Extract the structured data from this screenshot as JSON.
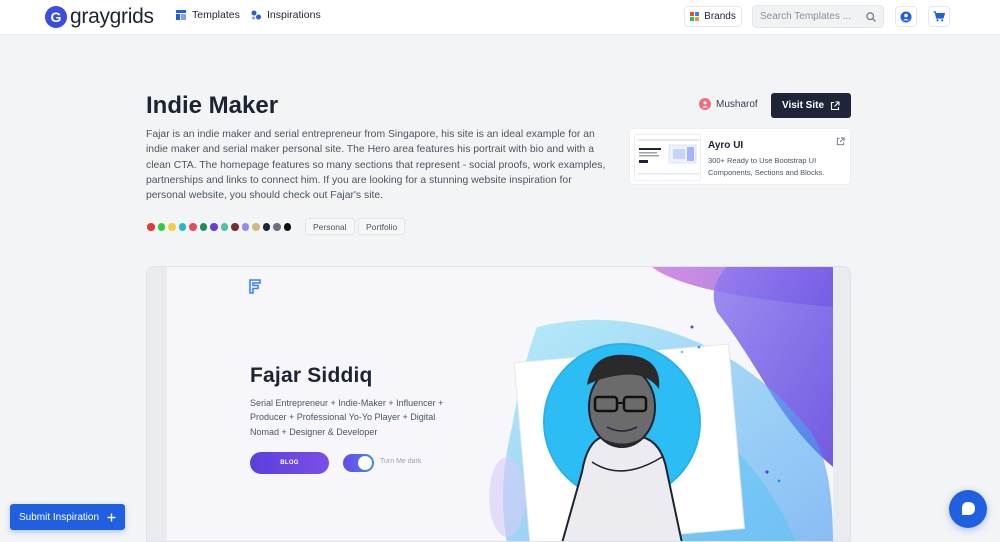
{
  "brand": {
    "logo_letter": "G",
    "name": "graygrids"
  },
  "nav": {
    "templates": "Templates",
    "inspirations": "Inspirations",
    "brands": "Brands",
    "search_placeholder": "Search Templates ..."
  },
  "page": {
    "title": "Indie Maker",
    "description": "Fajar is an indie maker and serial entrepreneur from Singapore, his site is an ideal example for an indie maker and serial maker personal site. The Hero area features his portrait with bio and with a clean CTA. The homepage features so many sections that represent - social proofs, work examples, partnerships and links to connect him. If you are looking for a stunning website inspiration for personal website, you should check out Fajar's site.",
    "author": "Musharof",
    "visit_label": "Visit Site",
    "tags": [
      "Personal",
      "Portfolio"
    ],
    "palette": [
      "#e53935",
      "#2ecc40",
      "#f4d03f",
      "#22b8cf",
      "#e74c5c",
      "#1e8c5a",
      "#6a3fd6",
      "#4fc3a1",
      "#7b2d2d",
      "#8f8fe6",
      "#d9b77c",
      "#1e2538",
      "#6b7280",
      "#111111"
    ]
  },
  "ad": {
    "title": "Ayro UI",
    "description": "300+ Ready to Use Bootstrap UI Components, Sections and Blocks."
  },
  "preview": {
    "name": "Fajar Siddiq",
    "bio": "Serial Entrepreneur + Indie-Maker + Influencer + Producer + Professional Yo-Yo Player + Digital Nomad + Designer & Developer",
    "blog_label": "BLOG",
    "dark_label": "Turn Me dark"
  },
  "floating": {
    "submit_label": "Submit Inspiration"
  },
  "colors": {
    "primary": "#1f5fe0",
    "dark": "#1e2538",
    "accent_purple": "#6a46e6"
  }
}
